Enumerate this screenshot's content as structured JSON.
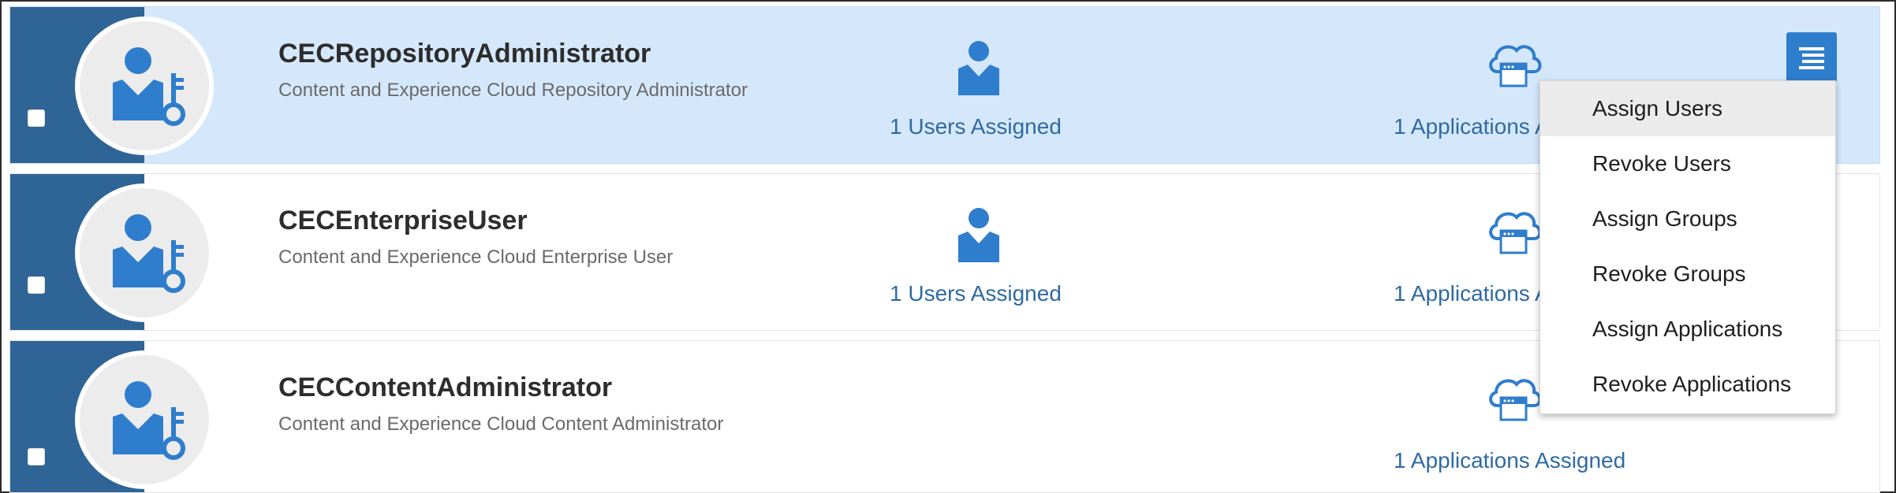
{
  "roles": [
    {
      "name": "CECRepositoryAdministrator",
      "description": "Content and Experience Cloud Repository Administrator",
      "users_assigned": "1 Users Assigned",
      "apps_assigned": "1 Applications Assigned",
      "selected": true
    },
    {
      "name": "CECEnterpriseUser",
      "description": "Content and Experience Cloud Enterprise User",
      "users_assigned": "1 Users Assigned",
      "apps_assigned": "1 Applications Assigned",
      "selected": false
    },
    {
      "name": "CECContentAdministrator",
      "description": "Content and Experience Cloud Content Administrator",
      "users_assigned": "",
      "apps_assigned": "1 Applications Assigned",
      "selected": false
    }
  ],
  "menu": {
    "items": [
      {
        "label": "Assign Users",
        "highlighted": true
      },
      {
        "label": "Revoke Users"
      },
      {
        "label": "Assign Groups"
      },
      {
        "label": "Revoke Groups"
      },
      {
        "label": "Assign Applications"
      },
      {
        "label": "Revoke Applications"
      }
    ]
  },
  "colors": {
    "accent": "#2f7dcd",
    "left_bar": "#2f6496",
    "selected_row": "#d5e8fb",
    "link": "#2f6aa3"
  },
  "icons": [
    "role-user-key-icon",
    "user-icon",
    "cloud-application-icon",
    "hamburger-menu-icon"
  ]
}
